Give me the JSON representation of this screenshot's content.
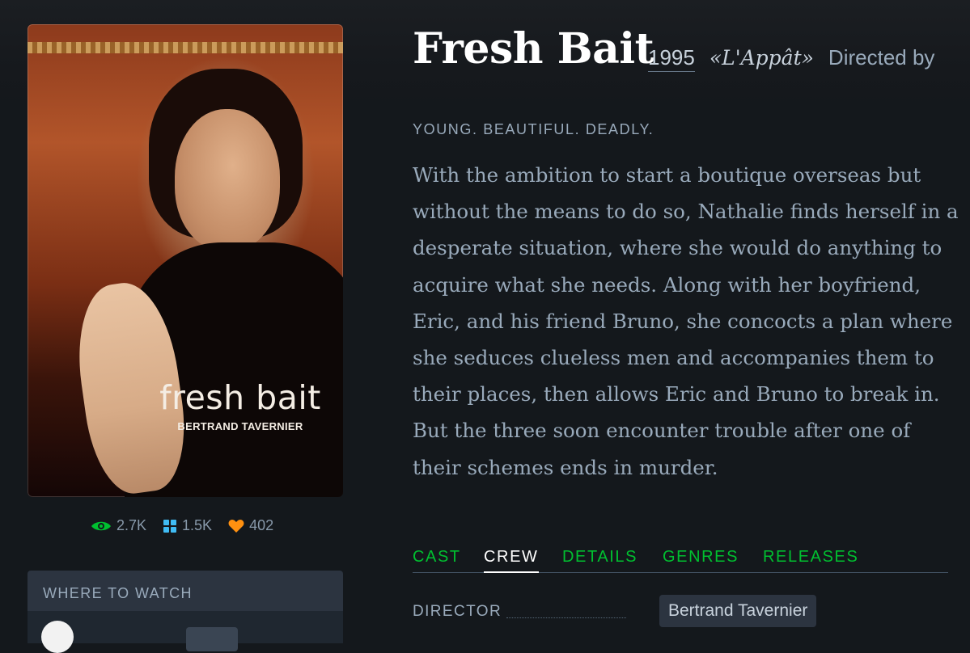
{
  "film": {
    "title": "Fresh Bait",
    "year": "1995",
    "original_title": "«L'Appât»",
    "directed_by_label": "Directed by",
    "tagline": "YOUNG. BEAUTIFUL. DEADLY.",
    "synopsis": "With the ambition to start a boutique overseas but without the means to do so, Nathalie finds herself in a desperate situation, where she would do anything to acquire what she needs. Along with her boyfriend, Eric, and his friend Bruno, she concocts a plan where she seduces clueless men and accompanies them to their places, then allows Eric and Bruno to break in. But the three soon encounter trouble after one of their schemes ends in murder."
  },
  "poster": {
    "title": "fresh bait",
    "credit": "BERTRAND TAVERNIER"
  },
  "stats": {
    "watched": "2.7K",
    "lists": "1.5K",
    "likes": "402"
  },
  "where_to_watch": {
    "heading": "WHERE TO WATCH"
  },
  "tabs": [
    {
      "label": "CAST",
      "active": false
    },
    {
      "label": "CREW",
      "active": true
    },
    {
      "label": "DETAILS",
      "active": false
    },
    {
      "label": "GENRES",
      "active": false
    },
    {
      "label": "RELEASES",
      "active": false
    }
  ],
  "crew": {
    "role": "DIRECTOR",
    "name": "Bertrand Tavernier"
  },
  "colors": {
    "background": "#14181c",
    "accent_green": "#00c030",
    "lists_blue": "#40bcf4",
    "likes_orange": "#ff9010"
  },
  "icons": {
    "watched": "eye-icon",
    "lists": "grid-icon",
    "likes": "heart-icon"
  }
}
